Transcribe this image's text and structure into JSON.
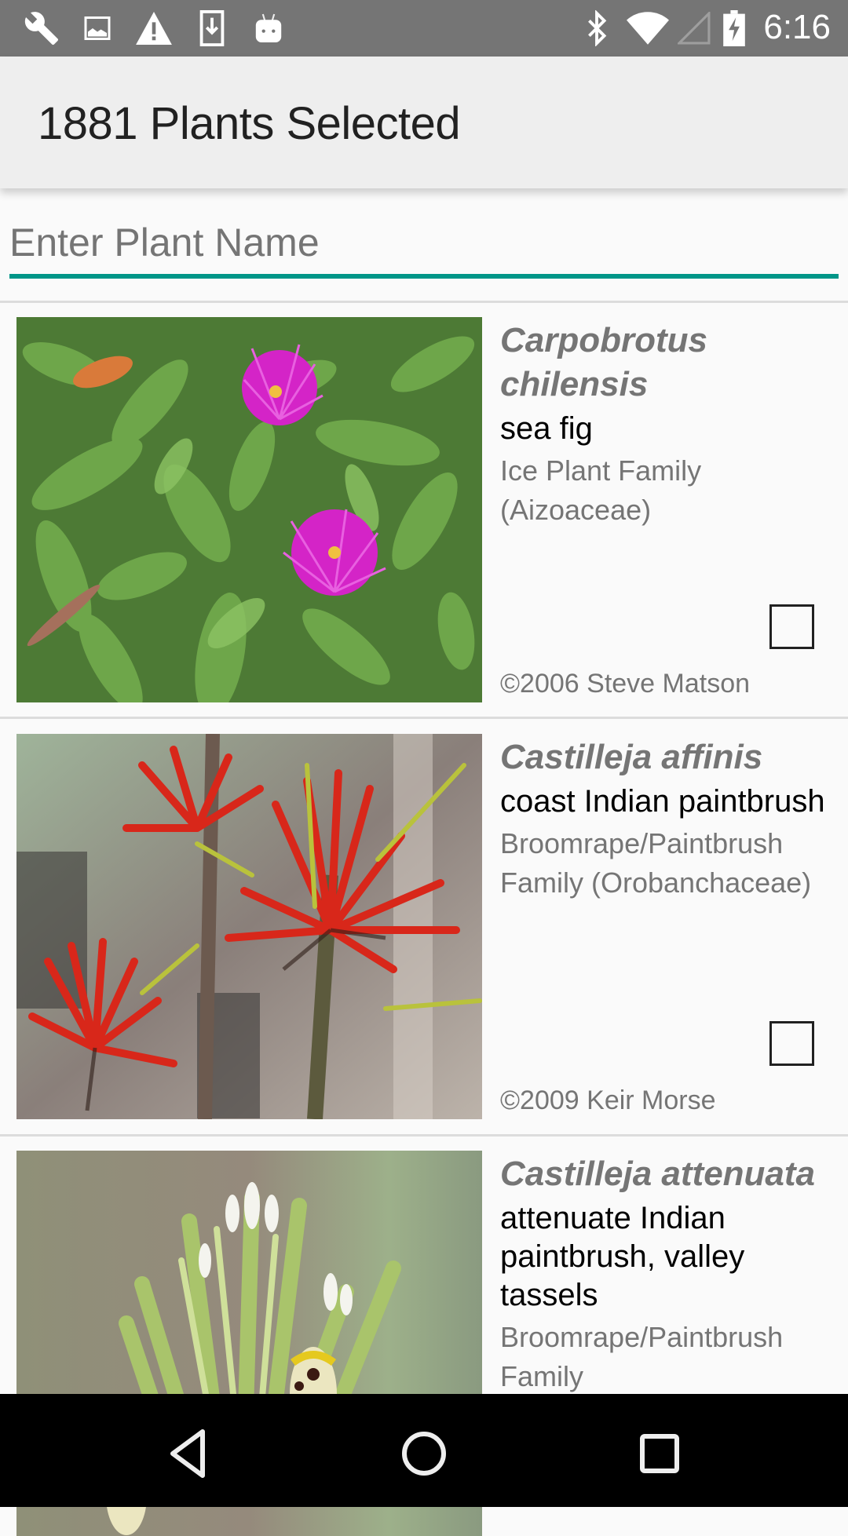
{
  "status_bar": {
    "time": "6:16",
    "left_icons": [
      "wrench-icon",
      "image-icon",
      "warning-icon",
      "download-icon",
      "android-icon"
    ],
    "right_icons": [
      "bluetooth-icon",
      "wifi-icon",
      "cell-signal-icon",
      "battery-charging-icon"
    ],
    "background": "#757575"
  },
  "app_bar": {
    "title": "1881 Plants Selected"
  },
  "search": {
    "value": "",
    "placeholder": "Enter Plant Name",
    "accent_color": "#009688"
  },
  "plants": [
    {
      "scientific_name": "Carpobrotus chilensis",
      "common_name": "sea fig",
      "family": "Ice Plant Family (Aizoaceae)",
      "copyright": "©2006 Steve Matson",
      "checked": false,
      "image_desc": "succulent green leaves with magenta flowers"
    },
    {
      "scientific_name": "Castilleja affinis",
      "common_name": "coast Indian paintbrush",
      "family": "Broomrape/Paintbrush Family (Orobanchaceae)",
      "copyright": "©2009 Keir Morse",
      "checked": false,
      "image_desc": "red paintbrush flower bracts"
    },
    {
      "scientific_name": "Castilleja attenuata",
      "common_name": "attenuate Indian paintbrush, valley tassels",
      "family": "Broomrape/Paintbrush Family",
      "copyright": "",
      "checked": false,
      "image_desc": "green spike with white tips"
    }
  ],
  "nav_bar": {
    "buttons": [
      "back",
      "home",
      "recents"
    ]
  }
}
